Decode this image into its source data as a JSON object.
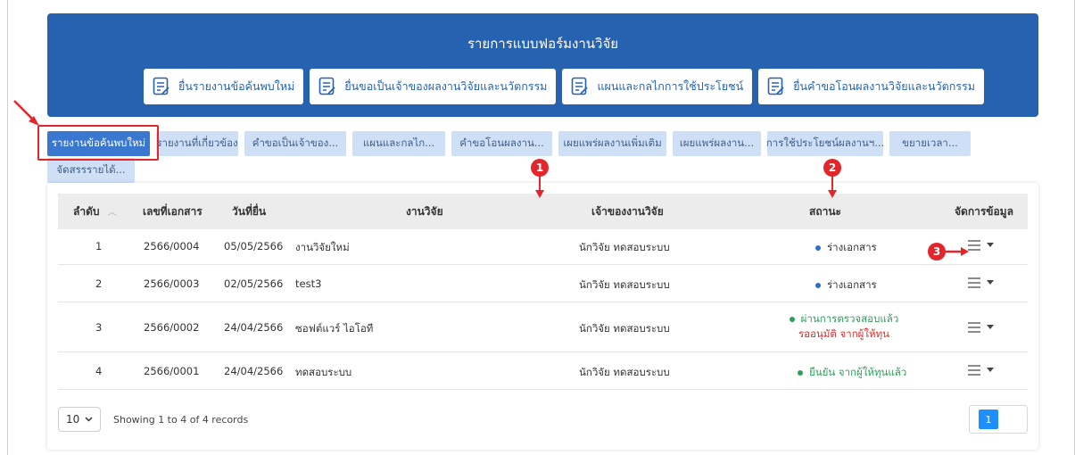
{
  "banner": {
    "title": "รายการแบบฟอร์มงานวิจัย",
    "actions": [
      {
        "label": "ยื่นรายงานข้อค้นพบใหม่",
        "icon": "form-icon"
      },
      {
        "label": "ยื่นขอเป็นเจ้าของผลงานวิจัยและนวัตกรรม",
        "icon": "form-icon"
      },
      {
        "label": "แผนและกลไกการใช้ประโยชน์",
        "icon": "form-icon"
      },
      {
        "label": "ยื่นคำขอโอนผลงานวิจัยและนวัตกรรม",
        "icon": "form-icon"
      }
    ]
  },
  "tabs": [
    {
      "label": "รายงานข้อค้นพบใหม่",
      "active": true
    },
    {
      "label": "รายงานที่เกี่ยวข้อง"
    },
    {
      "label": "คำขอเป็นเจ้าของ..."
    },
    {
      "label": "แผนและกลไก..."
    },
    {
      "label": "คำขอโอนผลงาน..."
    },
    {
      "label": "เผยแพร่ผลงานเพิ่มเติม"
    },
    {
      "label": "เผยแพร่ผลงาน..."
    },
    {
      "label": "การใช้ประโยชน์ผลงานฯ..."
    },
    {
      "label": "ขยายเวลา..."
    },
    {
      "label": "จัดสรรรายได้..."
    }
  ],
  "table": {
    "headers": {
      "order": "ลำดับ",
      "doc_no": "เลขที่เอกสาร",
      "date": "วันที่ยื่น",
      "research": "งานวิจัย",
      "owner": "เจ้าของงานวิจัย",
      "status": "สถานะ",
      "manage": "จัดการข้อมูล"
    },
    "sort_icon": "chevron-up-icon",
    "rows": [
      {
        "order": "1",
        "doc_no": "2566/0004",
        "date": "05/05/2566",
        "research": "งานวิจัยใหม่",
        "owner": "นักวิจัย ทดสอบระบบ",
        "status": "ร่างเอกสาร",
        "status_color": "#2f6fc8"
      },
      {
        "order": "2",
        "doc_no": "2566/0003",
        "date": "02/05/2566",
        "research": "test3",
        "owner": "นักวิจัย ทดสอบระบบ",
        "status": "ร่างเอกสาร",
        "status_color": "#2f6fc8"
      },
      {
        "order": "3",
        "doc_no": "2566/0002",
        "date": "24/04/2566",
        "research": "ซอฟต์แวร์ ไอโอที",
        "owner": "นักวิจัย ทดสอบระบบ",
        "status": "ผ่านการตรวจสอบแล้ว",
        "status_sub": "รออนุมัติ จากผู้ให้ทุน",
        "status_color": "#2e9f59"
      },
      {
        "order": "4",
        "doc_no": "2566/0001",
        "date": "24/04/2566",
        "research": "ทดสอบระบบ",
        "owner": "นักวิจัย ทดสอบระบบ",
        "status": "ยืนยัน จากผู้ให้ทุนแล้ว",
        "status_color": "#2e9f59"
      }
    ]
  },
  "footer": {
    "page_size": "10",
    "showing": "Showing 1 to 4 of 4 records",
    "current_page": "1"
  },
  "annotations": {
    "markers": [
      "1",
      "2",
      "3"
    ],
    "color": "#e3262b"
  },
  "colors": {
    "banner": "#2762b0",
    "tab": "#cfe0f6",
    "tab_active": "#3a78cf",
    "page_button": "#1e8fff"
  }
}
